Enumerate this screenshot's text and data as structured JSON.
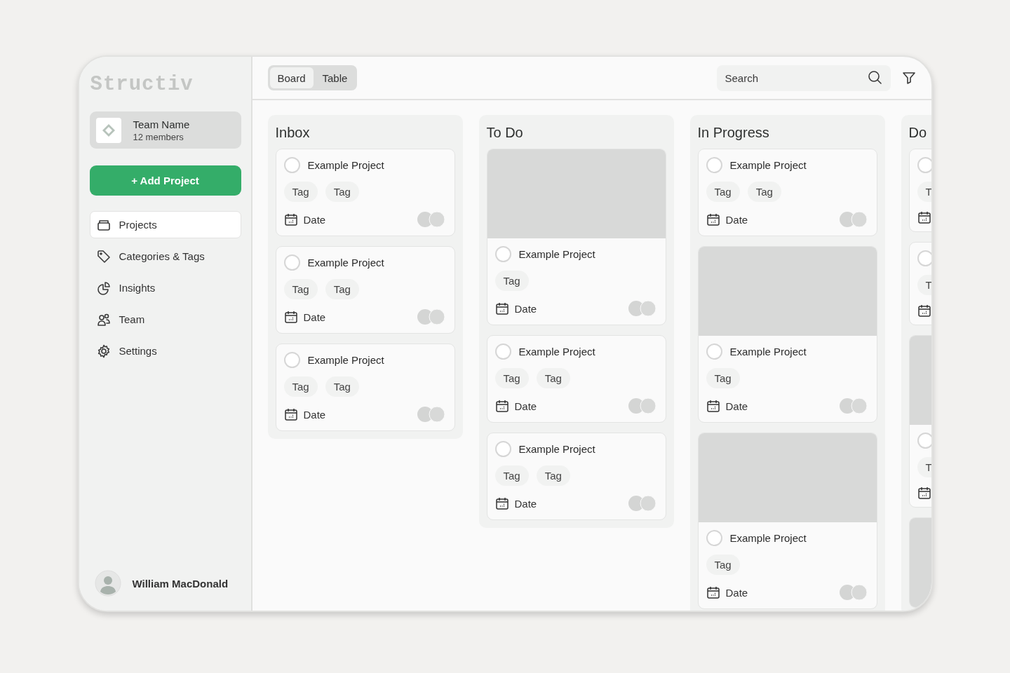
{
  "sidebar": {
    "logo": "Structiv",
    "team": {
      "name": "Team Name",
      "members": "12 members"
    },
    "add_button": "+ Add Project",
    "items": [
      {
        "label": "Projects",
        "selected": true
      },
      {
        "label": "Categories & Tags",
        "selected": false
      },
      {
        "label": "Insights",
        "selected": false
      },
      {
        "label": "Team",
        "selected": false
      },
      {
        "label": "Settings",
        "selected": false
      }
    ],
    "user": {
      "name": "William MacDonald"
    }
  },
  "toolbar": {
    "views": [
      {
        "label": "Board",
        "selected": true
      },
      {
        "label": "Table",
        "selected": false
      }
    ],
    "search": {
      "placeholder": "Search"
    }
  },
  "columns": [
    {
      "title": "Inbox",
      "cards": [
        {
          "kind": "task",
          "title": "Example Project",
          "checked": false,
          "tags": [
            "Tag",
            "Tag"
          ],
          "date": "Date"
        },
        {
          "kind": "task",
          "title": "Example Project",
          "checked": false,
          "tags": [
            "Tag",
            "Tag"
          ],
          "date": "Date"
        },
        {
          "kind": "task",
          "title": "Example Project",
          "checked": false,
          "tags": [
            "Tag",
            "Tag"
          ],
          "date": "Date"
        }
      ]
    },
    {
      "title": "To Do",
      "cards": [
        {
          "kind": "cover",
          "title": "Example Project",
          "checked": false,
          "tags": [
            "Tag"
          ],
          "date": "Date"
        },
        {
          "kind": "task",
          "title": "Example Project",
          "checked": false,
          "tags": [
            "Tag",
            "Tag"
          ],
          "date": "Date"
        },
        {
          "kind": "task",
          "title": "Example Project",
          "checked": false,
          "tags": [
            "Tag",
            "Tag"
          ],
          "date": "Date"
        }
      ]
    },
    {
      "title": "In Progress",
      "cards": [
        {
          "kind": "task",
          "title": "Example Project",
          "checked": false,
          "tags": [
            "Tag",
            "Tag"
          ],
          "date": "Date"
        },
        {
          "kind": "cover",
          "title": "Example Project",
          "checked": false,
          "tags": [
            "Tag"
          ],
          "date": "Date"
        },
        {
          "kind": "cover",
          "title": "Example Project",
          "checked": false,
          "tags": [
            "Tag"
          ],
          "date": "Date"
        }
      ]
    },
    {
      "title": "Do",
      "cards": [
        {
          "kind": "task",
          "checked": false,
          "tags": [
            "T"
          ]
        },
        {
          "kind": "task",
          "checked": false,
          "tags": [
            "T"
          ]
        },
        {
          "kind": "cover",
          "checked": false,
          "tags": [
            "T"
          ]
        },
        {
          "kind": "cover"
        }
      ]
    }
  ]
}
